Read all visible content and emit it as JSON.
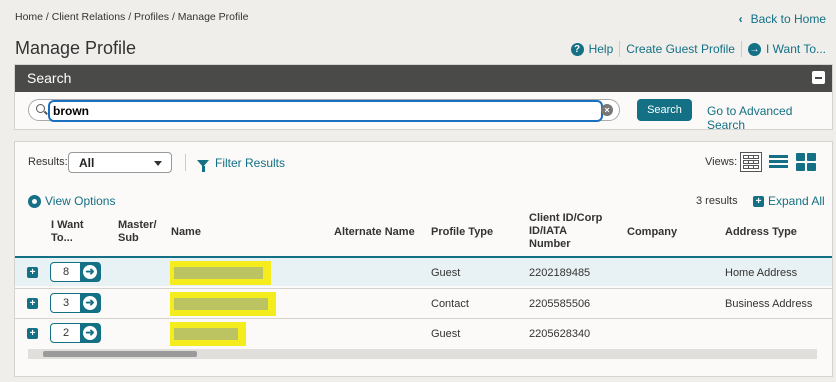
{
  "breadcrumb": "Home / Client Relations / Profiles / Manage Profile",
  "back_home": "Back to Home",
  "page_title": "Manage Profile",
  "top_links": {
    "help": "Help",
    "create_guest": "Create Guest Profile",
    "i_want_to": "I Want To..."
  },
  "search": {
    "title": "Search",
    "value": "brown",
    "button": "Search",
    "advanced": "Go to Advanced Search"
  },
  "results": {
    "label": "Results:",
    "filter_value": "All",
    "filter_results": "Filter Results",
    "views_label": "Views:",
    "view_options": "View Options",
    "count": "3 results",
    "expand_all": "Expand All",
    "columns": {
      "i_want_to_1": "I Want",
      "i_want_to_2": "To...",
      "master_1": "Master/",
      "master_2": "Sub",
      "name": "Name",
      "alt_name": "Alternate Name",
      "profile_type": "Profile Type",
      "client_id_1": "Client ID/Corp",
      "client_id_2": "ID/IATA",
      "client_id_3": "Number",
      "company": "Company",
      "address_type": "Address Type"
    },
    "rows": [
      {
        "count": "8",
        "profile_type": "Guest",
        "client_id": "2202189485",
        "address_type": "Home Address"
      },
      {
        "count": "3",
        "profile_type": "Contact",
        "client_id": "2205585506",
        "address_type": "Business Address"
      },
      {
        "count": "2",
        "profile_type": "Guest",
        "client_id": "2205628340",
        "address_type": ""
      }
    ]
  },
  "colors": {
    "accent": "#137085",
    "header_bar": "#4a4a49",
    "redaction": "#f5ec1e"
  }
}
